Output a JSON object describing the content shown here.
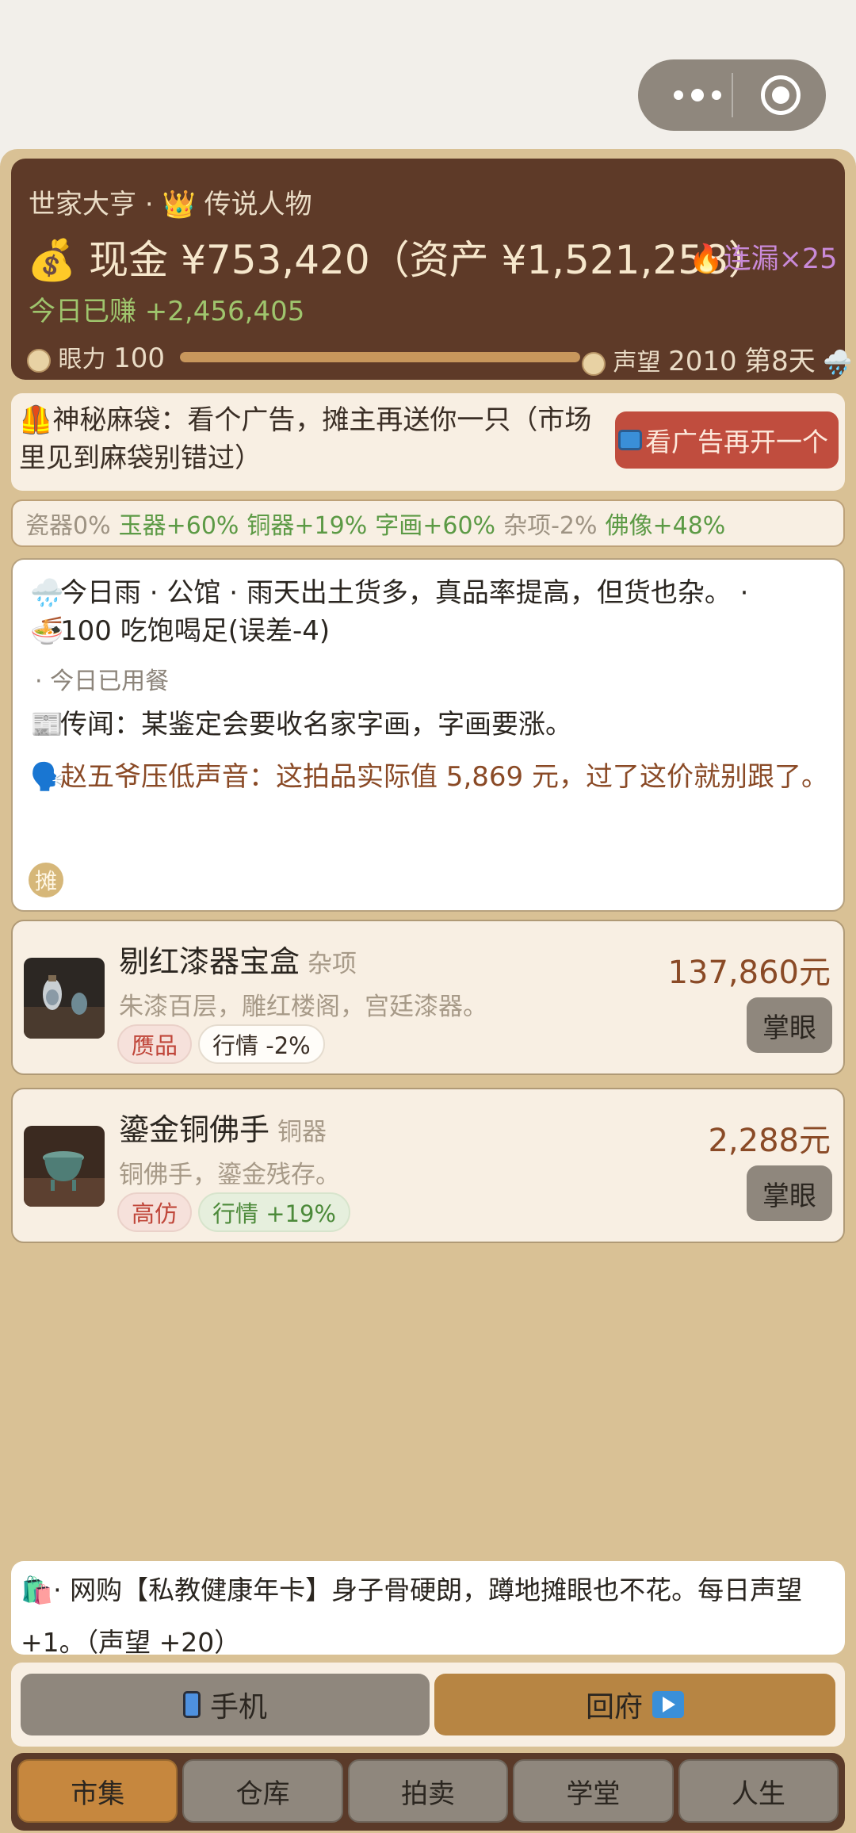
{
  "menu_capsule": {
    "more_icon": "more-dots-icon",
    "close_icon": "target-icon"
  },
  "status": {
    "title": "世家大亨",
    "separator": "·",
    "rank_icon": "crown-icon",
    "rank": "传说人物",
    "cash_label": "现金 ¥753,420（资产 ¥1,521,258）",
    "streak": "连漏×25",
    "today_earned": "今日已赚 +2,456,405",
    "eye_label": "眼力",
    "eye_value": "100",
    "eye_fraction": 1.0,
    "reputation_label": "声望",
    "reputation_value": "2010",
    "day": "第8天",
    "weather_icon": "rain-cloud-icon"
  },
  "ad_banner": {
    "text": "神秘麻袋：看个广告，摊主再送你一只（市场里见到麻袋别错过）",
    "button": "看广告再开一个"
  },
  "market_trends": [
    {
      "label": "瓷器0%",
      "trend": "neutral"
    },
    {
      "label": "玉器+60%",
      "trend": "up"
    },
    {
      "label": "铜器+19%",
      "trend": "up"
    },
    {
      "label": "字画+60%",
      "trend": "up"
    },
    {
      "label": "杂项-2%",
      "trend": "down"
    },
    {
      "label": "佛像+48%",
      "trend": "up"
    }
  ],
  "news": {
    "weather_line": "今日雨 · 公馆 · 雨天出土货多，真品率提高，但货也杂。 ·",
    "food_line": "100 吃饱喝足(误差-4)",
    "meal_status": "· 今日已用餐",
    "rumor": "传闻：某鉴定会要收名家字画，字画要涨。",
    "tip": "赵五爷压低声音：这拍品实际值 5,869 元，过了这价就别跟了。",
    "stall_badge": "摊"
  },
  "items": [
    {
      "name": "剔红漆器宝盒",
      "category": "杂项",
      "desc": "朱漆百层，雕红楼阁，宫廷漆器。",
      "tag_quality": "赝品",
      "tag_market": "行情 -2%",
      "price": "137,860元",
      "action": "掌眼"
    },
    {
      "name": "鎏金铜佛手",
      "category": "铜器",
      "desc": "铜佛手，鎏金残存。",
      "tag_quality": "高仿",
      "tag_market": "行情 +19%",
      "price": "2,288元",
      "action": "掌眼"
    }
  ],
  "notice": {
    "text": "· 网购【私教健康年卡】身子骨硬朗，蹲地摊眼也不花。每日声望+1。（声望 +20）"
  },
  "actions": {
    "phone": "手机",
    "home": "回府"
  },
  "tabs": [
    "市集",
    "仓库",
    "拍卖",
    "学堂",
    "人生"
  ],
  "colors": {
    "background": "#d9c195",
    "status_card": "#5e3a28",
    "accent_orange": "#c6873e",
    "ad_button": "#c04d3e",
    "trend_up": "#5c9a45"
  }
}
